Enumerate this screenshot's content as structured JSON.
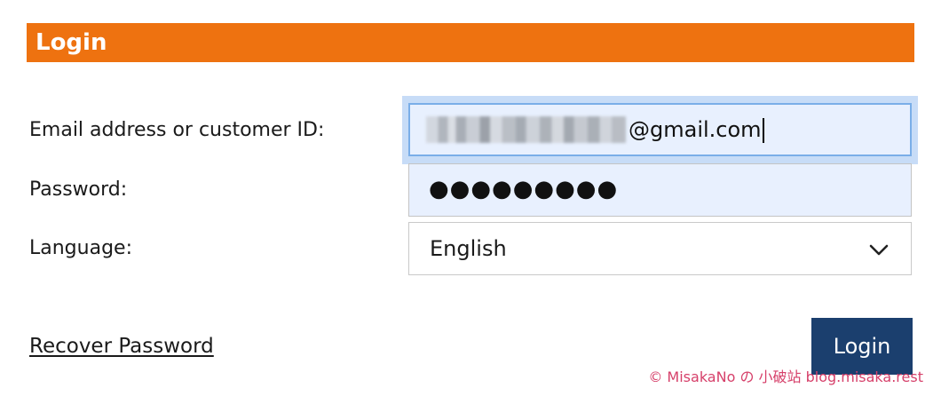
{
  "header": {
    "title": "Login"
  },
  "form": {
    "email_label": "Email address or customer ID:",
    "email_value_visible": "@gmail.com",
    "password_label": "Password:",
    "password_value_masked": "●●●●●●●●●",
    "language_label": "Language:",
    "language_selected": "English"
  },
  "actions": {
    "recover_label": "Recover Password",
    "login_label": "Login"
  },
  "watermark": {
    "text": "© MisakaNo の 小破站 blog.misaka.rest"
  },
  "icons": {
    "language_dropdown": "chevron-down-icon"
  },
  "colors": {
    "header_bg": "#ee7210",
    "login_button_bg": "#1b3f6e",
    "autofill_bg": "#e8f0fe",
    "focus_border": "#7aaee8",
    "watermark": "#d6406a"
  }
}
